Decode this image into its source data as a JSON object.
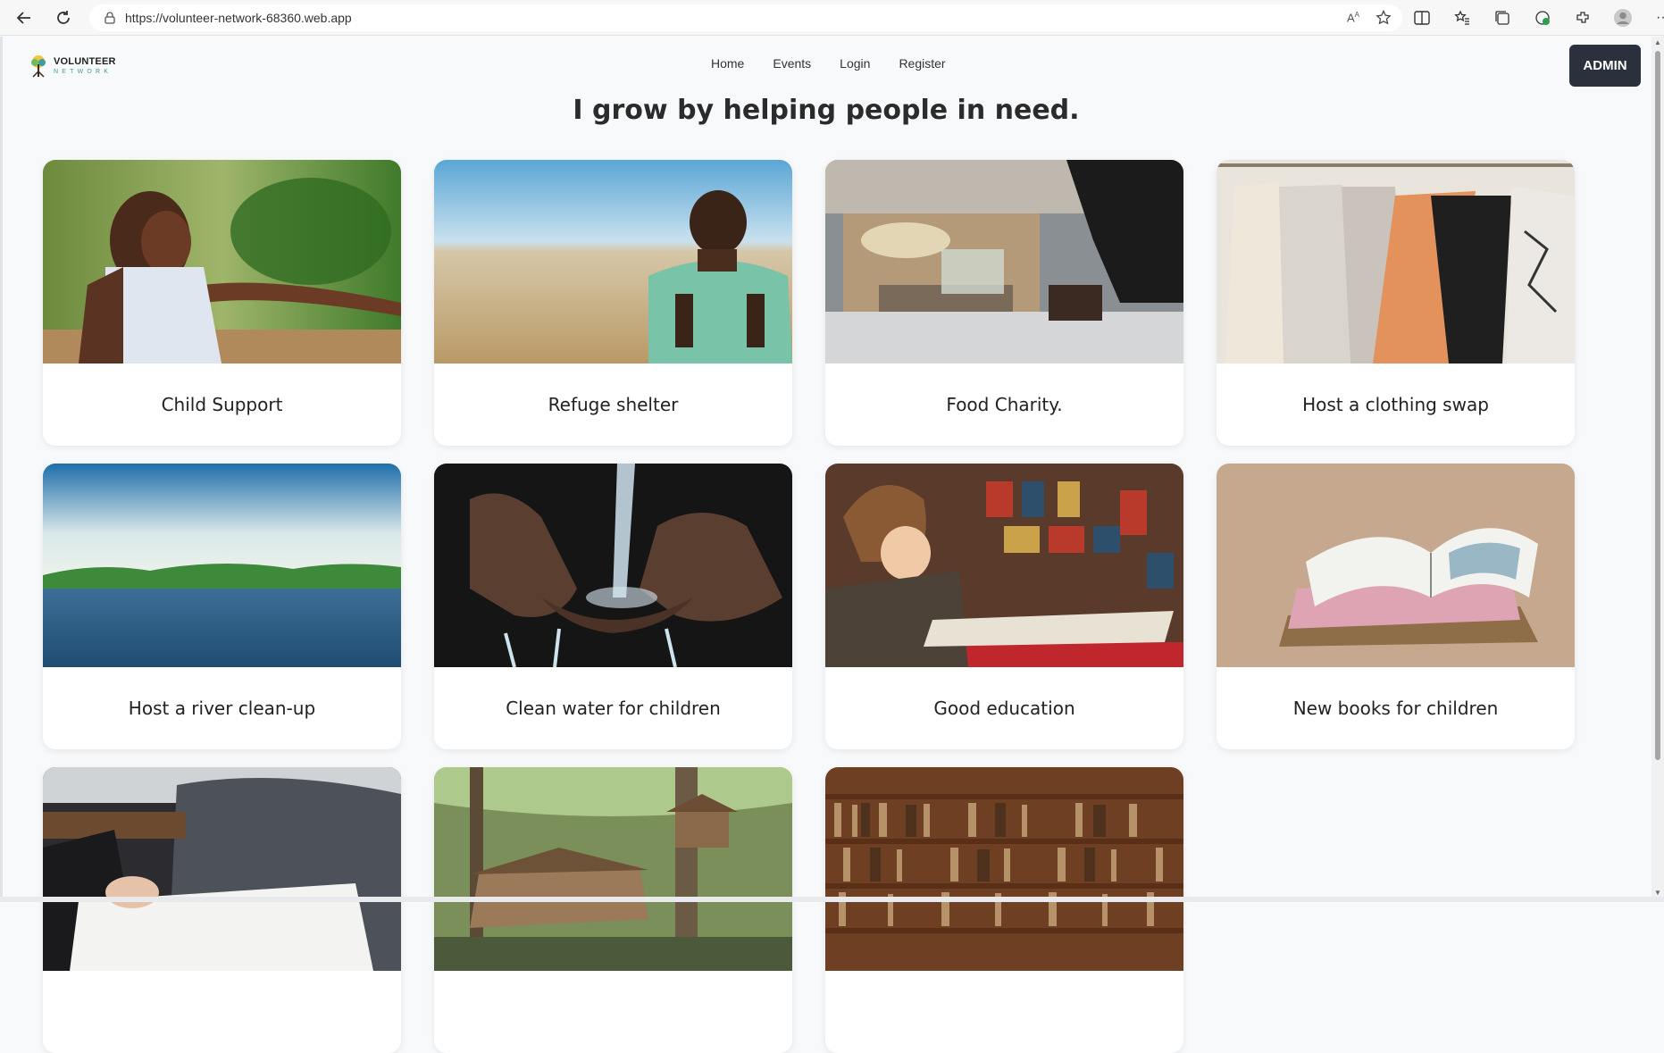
{
  "browser": {
    "url": "https://volunteer-network-68360.web.app"
  },
  "logo": {
    "main": "VOLUNTEER",
    "sub": "NETWORK"
  },
  "nav": {
    "items": [
      "Home",
      "Events",
      "Login",
      "Register"
    ],
    "admin_label": "ADMIN"
  },
  "headline": "I grow by helping people in need.",
  "cards": [
    {
      "title": "Child Support",
      "image": "girl-smiling-outdoors"
    },
    {
      "title": "Refuge shelter",
      "image": "boy-in-field"
    },
    {
      "title": "Food Charity.",
      "image": "food-distribution"
    },
    {
      "title": "Host a clothing swap",
      "image": "clothes-rack"
    },
    {
      "title": "Host a river clean-up",
      "image": "river-landscape"
    },
    {
      "title": "Clean water for children",
      "image": "water-in-hands"
    },
    {
      "title": "Good education",
      "image": "boy-reading-library"
    },
    {
      "title": "New books for children",
      "image": "open-book"
    },
    {
      "title": "",
      "image": "person-reading-paper"
    },
    {
      "title": "",
      "image": "birdhouses-forest"
    },
    {
      "title": "",
      "image": "bookshelves"
    }
  ],
  "colors": {
    "admin_bg": "#2a313c",
    "page_bg": "#f7f9fb",
    "logo_accent": "#3b9ea0"
  }
}
